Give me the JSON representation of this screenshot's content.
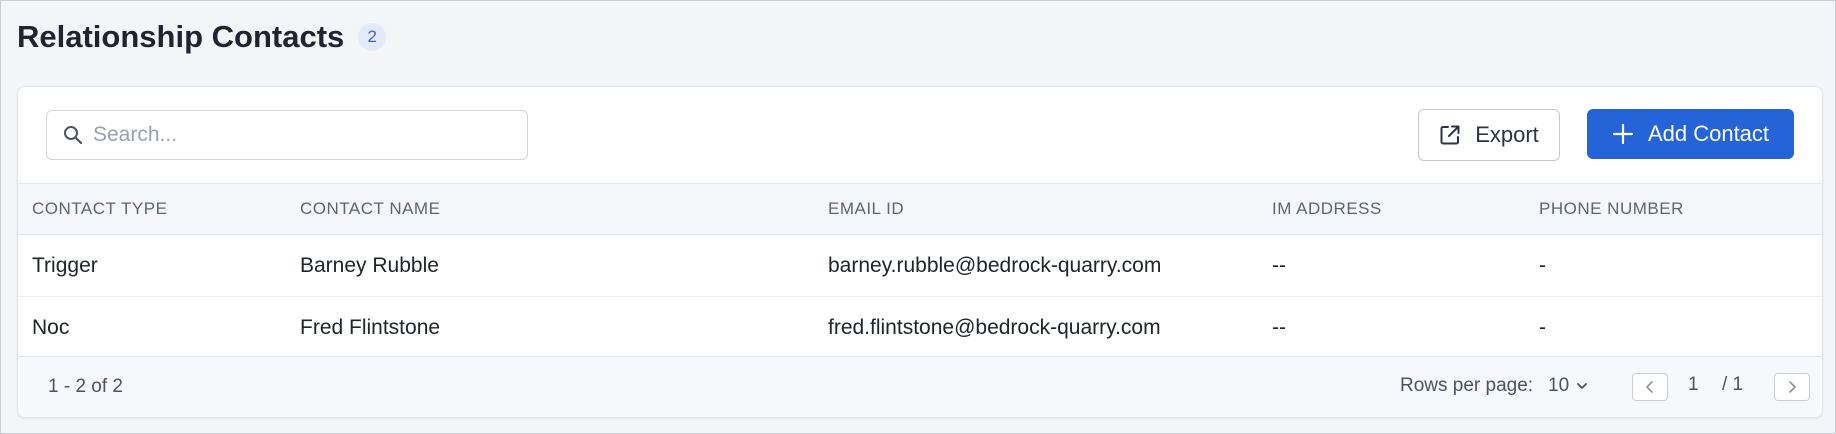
{
  "page": {
    "title": "Relationship Contacts",
    "count": "2"
  },
  "toolbar": {
    "search_placeholder": "Search...",
    "export_label": "Export",
    "add_label": "Add Contact"
  },
  "table": {
    "columns": [
      "CONTACT TYPE",
      "CONTACT NAME",
      "EMAIL ID",
      "IM ADDRESS",
      "PHONE NUMBER"
    ],
    "rows": [
      [
        "Trigger",
        "Barney Rubble",
        "barney.rubble@bedrock-quarry.com",
        "--",
        "-"
      ],
      [
        "Noc",
        "Fred Flintstone",
        "fred.flintstone@bedrock-quarry.com",
        "--",
        "-"
      ]
    ]
  },
  "footer": {
    "range": "1 - 2 of 2",
    "rows_per_page_label": "Rows per page:",
    "rows_per_page_value": "10",
    "current_page": "1",
    "total_pages": "/ 1"
  },
  "colors": {
    "accent": "#2563d9",
    "badge_bg": "#e4ebf8"
  },
  "icons": [
    "search-icon",
    "external-link-icon",
    "plus-icon",
    "chevron-down-icon",
    "chevron-left-icon",
    "chevron-right-icon"
  ]
}
